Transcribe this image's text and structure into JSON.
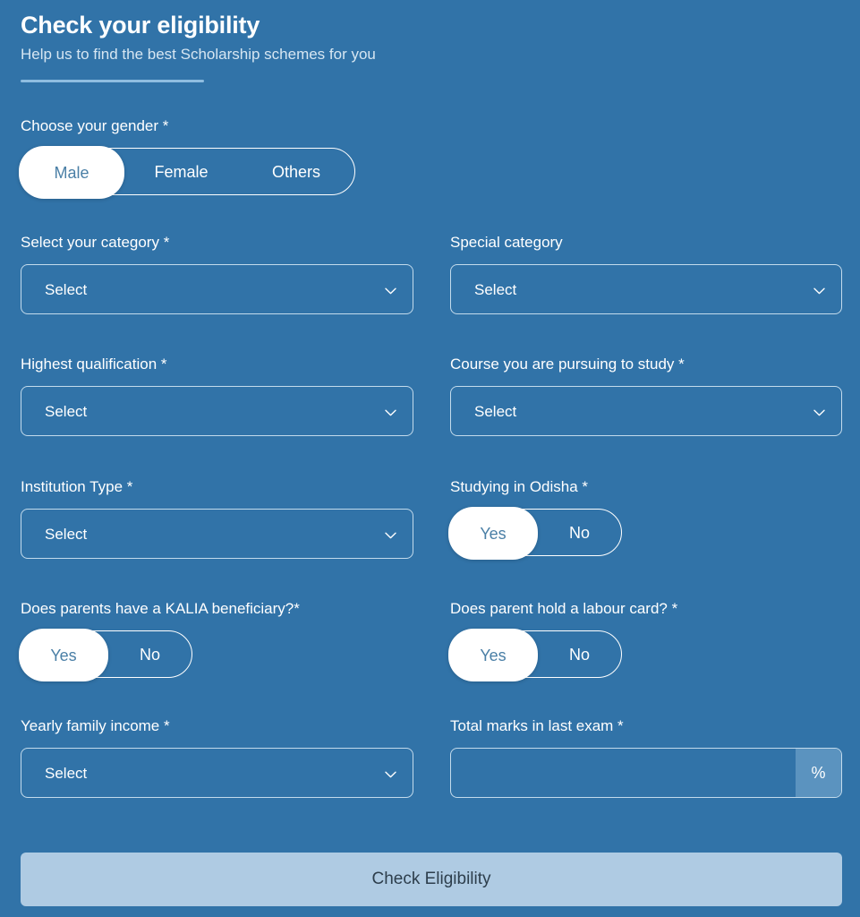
{
  "header": {
    "title": "Check your eligibility",
    "subtitle": "Help us to find the best Scholarship schemes for you"
  },
  "form": {
    "gender": {
      "label": "Choose your gender *",
      "options": [
        "Male",
        "Female",
        "Others"
      ],
      "selected": "Male"
    },
    "category": {
      "label": "Select your category *",
      "value": "Select"
    },
    "special_category": {
      "label": "Special category",
      "value": "Select"
    },
    "highest_qualification": {
      "label": "Highest qualification *",
      "value": "Select"
    },
    "course": {
      "label": "Course you are pursuing to study *",
      "value": "Select"
    },
    "institution_type": {
      "label": "Institution Type *",
      "value": "Select"
    },
    "studying_in_odisha": {
      "label": "Studying in Odisha *",
      "options": [
        "Yes",
        "No"
      ],
      "selected": "Yes"
    },
    "kalia_beneficiary": {
      "label": "Does parents have a KALIA beneficiary?*",
      "options": [
        "Yes",
        "No"
      ],
      "selected": "Yes"
    },
    "labour_card": {
      "label": "Does parent hold a labour card? *",
      "options": [
        "Yes",
        "No"
      ],
      "selected": "Yes"
    },
    "yearly_family_income": {
      "label": "Yearly family income *",
      "value": "Select"
    },
    "total_marks": {
      "label": "Total marks in last exam *",
      "value": "",
      "placeholder": "",
      "suffix": "%"
    }
  },
  "submit": {
    "label": "Check Eligibility"
  },
  "colors": {
    "background": "#3173a8",
    "accent_light": "#afcbe3",
    "selected_pill_text": "#4a7fa6",
    "suffix_bg": "#5b93bf"
  }
}
